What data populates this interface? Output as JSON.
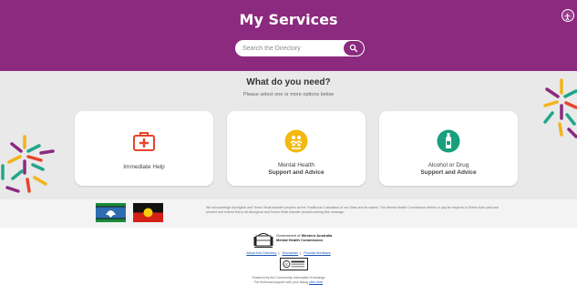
{
  "header": {
    "title": "My Services",
    "search_placeholder": "Search the Directory"
  },
  "main": {
    "question": "What do you need?",
    "instruction": "Please select one or more options below",
    "cards": [
      {
        "label_line1": "Immediate Help",
        "label_line2": "",
        "icon": "first-aid-kit-icon",
        "icon_color": "#e8432c"
      },
      {
        "label_line1": "Mental Health",
        "label_line2": "Support and Advice",
        "icon": "people-support-icon",
        "icon_color": "#f2b90f"
      },
      {
        "label_line1": "Alcohol or Drug",
        "label_line2": "Support and Advice",
        "icon": "bottle-icon",
        "icon_color": "#18a07c"
      }
    ]
  },
  "acknowledgement": {
    "text": "We acknowledge Aboriginal and Torres Strait Islander peoples as the Traditional Custodians of our State and its waters. The Mental Health Commission wishes to pay its respects to Elders both past and present and extend this to all Aboriginal and Torres Strait Islander peoples seeing this message."
  },
  "footer": {
    "gov_line1": "Government of",
    "gov_line1_bold": "Western Australia",
    "gov_line2": "Mental Health Commission",
    "links": [
      "About this Directory",
      "Disclaimer",
      "Provide feedback"
    ],
    "powered_line1": "Powered by the Community Information Exchange",
    "powered_line2": "For technical support with your listing",
    "powered_link": "click here"
  },
  "colors": {
    "brand": "#8b2a7e",
    "band": "#e9e9e9",
    "link": "#1a55b5"
  }
}
